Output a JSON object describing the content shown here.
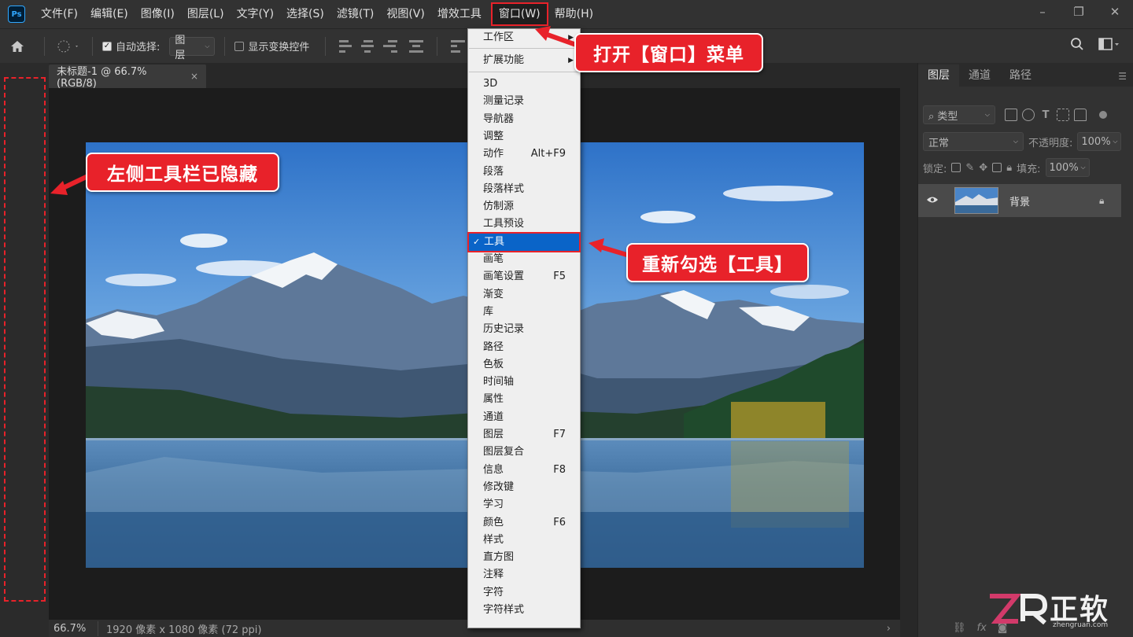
{
  "menubar": {
    "logo": "Ps",
    "items": [
      {
        "label": "文件(F)"
      },
      {
        "label": "编辑(E)"
      },
      {
        "label": "图像(I)"
      },
      {
        "label": "图层(L)"
      },
      {
        "label": "文字(Y)"
      },
      {
        "label": "选择(S)"
      },
      {
        "label": "滤镜(T)"
      },
      {
        "label": "视图(V)"
      },
      {
        "label": "增效工具"
      },
      {
        "label": "窗口(W)"
      },
      {
        "label": "帮助(H)"
      }
    ],
    "window_controls": {
      "minimize": "–",
      "restore": "❐",
      "close": "✕"
    }
  },
  "options": {
    "home_icon": "home-icon",
    "auto_select_label": "自动选择:",
    "auto_select_checked": true,
    "layer_dropdown": "图层",
    "show_transform_label": "显示变换控件",
    "show_transform_checked": false
  },
  "document": {
    "tab_title": "未标题-1 @ 66.7% (RGB/8)",
    "tab_close": "×",
    "zoom": "66.7%",
    "info": "1920 像素 x 1080 像素 (72 ppi)",
    "info_arrow": "›"
  },
  "layers_panel": {
    "tabs": [
      "图层",
      "通道",
      "路径"
    ],
    "filter_kind": "类型",
    "blend_mode": "正常",
    "opacity_label": "不透明度:",
    "opacity_value": "100%",
    "lock_label": "锁定:",
    "fill_label": "填充:",
    "fill_value": "100%",
    "layer_name": "背景"
  },
  "window_menu": {
    "items": [
      {
        "label": "工作区",
        "shortcut": "",
        "submenu": true
      },
      {
        "label": "扩展功能",
        "shortcut": "",
        "submenu": true
      },
      {
        "label": "3D",
        "shortcut": ""
      },
      {
        "label": "测量记录",
        "shortcut": ""
      },
      {
        "label": "导航器",
        "shortcut": ""
      },
      {
        "label": "调整",
        "shortcut": ""
      },
      {
        "label": "动作",
        "shortcut": "Alt+F9"
      },
      {
        "label": "段落",
        "shortcut": ""
      },
      {
        "label": "段落样式",
        "shortcut": ""
      },
      {
        "label": "仿制源",
        "shortcut": ""
      },
      {
        "label": "工具预设",
        "shortcut": ""
      },
      {
        "label": "工具",
        "shortcut": "",
        "checked": true
      },
      {
        "label": "画笔",
        "shortcut": ""
      },
      {
        "label": "画笔设置",
        "shortcut": "F5"
      },
      {
        "label": "渐变",
        "shortcut": ""
      },
      {
        "label": "库",
        "shortcut": ""
      },
      {
        "label": "历史记录",
        "shortcut": ""
      },
      {
        "label": "路径",
        "shortcut": ""
      },
      {
        "label": "色板",
        "shortcut": ""
      },
      {
        "label": "时间轴",
        "shortcut": ""
      },
      {
        "label": "属性",
        "shortcut": ""
      },
      {
        "label": "通道",
        "shortcut": ""
      },
      {
        "label": "图层",
        "shortcut": "F7"
      },
      {
        "label": "图层复合",
        "shortcut": ""
      },
      {
        "label": "信息",
        "shortcut": "F8"
      },
      {
        "label": "修改键",
        "shortcut": ""
      },
      {
        "label": "学习",
        "shortcut": ""
      },
      {
        "label": "颜色",
        "shortcut": "F6"
      },
      {
        "label": "样式",
        "shortcut": ""
      },
      {
        "label": "直方图",
        "shortcut": ""
      },
      {
        "label": "注释",
        "shortcut": ""
      },
      {
        "label": "字符",
        "shortcut": ""
      },
      {
        "label": "字符样式",
        "shortcut": ""
      }
    ],
    "check_mark": "✓",
    "submenu_arrow": "▶"
  },
  "callouts": {
    "open_window_menu": "打开【窗口】菜单",
    "toolbar_hidden": "左侧工具栏已隐藏",
    "recheck_tools": "重新勾选【工具】"
  },
  "watermark": {
    "brand_cn": "正软",
    "brand_url": "zhengruan.com"
  },
  "colors": {
    "accent_red": "#e8222a",
    "menu_highlight": "#0a64c8",
    "ps_blue": "#31a8ff"
  }
}
